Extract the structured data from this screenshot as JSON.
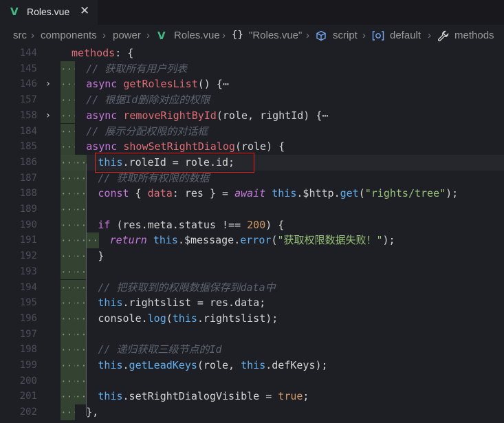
{
  "tab": {
    "vue_icon": "V",
    "name": "Roles.vue",
    "close": "✕"
  },
  "breadcrumb": {
    "items": [
      "src",
      "components",
      "power"
    ],
    "file_icon": "V",
    "file": "Roles.vue",
    "braces_icon": "{}",
    "module": "\"Roles.vue\"",
    "script_icon": "cube-icon",
    "script": "script",
    "default_icon": "object-icon",
    "default": "default",
    "methods_icon": "wrench-icon",
    "methods": "methods"
  },
  "lines": [
    {
      "n": "144",
      "code": "methods: {"
    },
    {
      "n": "145",
      "code": "// 获取所有用户列表"
    },
    {
      "n": "146",
      "code": "async getRolesList() {⋯"
    },
    {
      "n": "157",
      "code": "// 根据Id删除对应的权限"
    },
    {
      "n": "158",
      "code": "async removeRightById(role, rightId) {⋯"
    },
    {
      "n": "184",
      "code": "// 展示分配权限的对话框"
    },
    {
      "n": "185",
      "code": "async showSetRightDialog(role) {"
    },
    {
      "n": "186",
      "code": "this.roleId = role.id;"
    },
    {
      "n": "187",
      "code": "// 获取所有权限的数据"
    },
    {
      "n": "188",
      "code": "const { data: res } = await this.$http.get(\"rights/tree\");"
    },
    {
      "n": "189",
      "code": ""
    },
    {
      "n": "190",
      "code": "if (res.meta.status !== 200) {"
    },
    {
      "n": "191",
      "code": "return this.$message.error(\"获取权限数据失败！\");"
    },
    {
      "n": "192",
      "code": "}"
    },
    {
      "n": "193",
      "code": ""
    },
    {
      "n": "194",
      "code": "// 把获取到的权限数据保存到data中"
    },
    {
      "n": "195",
      "code": "this.rightslist = res.data;"
    },
    {
      "n": "196",
      "code": "console.log(this.rightslist);"
    },
    {
      "n": "197",
      "code": ""
    },
    {
      "n": "198",
      "code": "// 递归获取三级节点的Id"
    },
    {
      "n": "199",
      "code": "this.getLeadKeys(role, this.defKeys);"
    },
    {
      "n": "200",
      "code": ""
    },
    {
      "n": "201",
      "code": "this.setRightDialogVisible = true;"
    },
    {
      "n": "202",
      "code": "},"
    }
  ],
  "fold_icon": "›",
  "colors": {
    "keyword": "#c678dd",
    "function": "#e06c75",
    "comment": "#5c6370",
    "string": "#98c379",
    "number": "#d19a66",
    "highlight_box": "#e8221e"
  }
}
